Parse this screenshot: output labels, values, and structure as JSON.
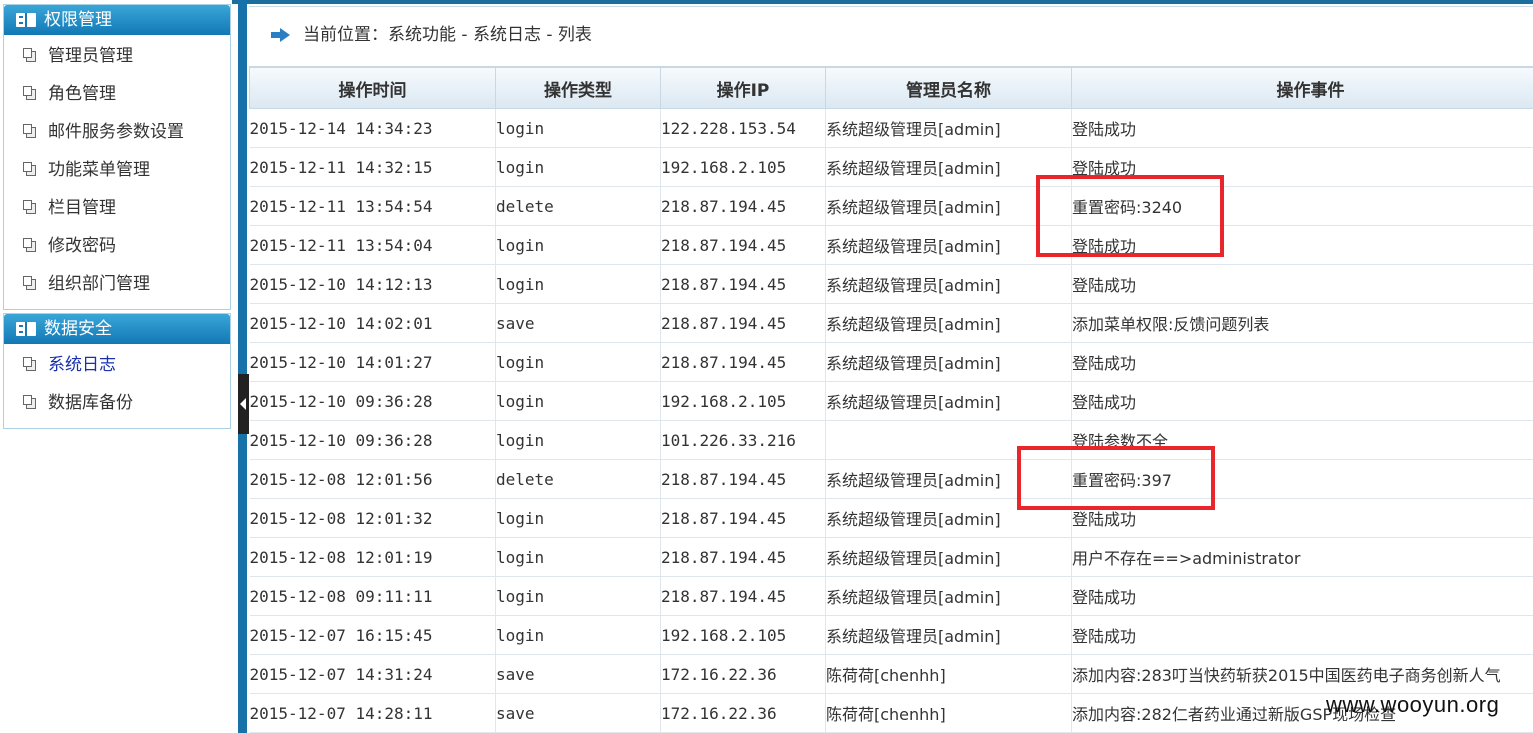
{
  "sidebar": {
    "panels": [
      {
        "title": "权限管理",
        "items": [
          "管理员管理",
          "角色管理",
          "邮件服务参数设置",
          "功能菜单管理",
          "栏目管理",
          "修改密码",
          "组织部门管理"
        ]
      },
      {
        "title": "数据安全",
        "items": [
          "系统日志",
          "数据库备份"
        ]
      }
    ],
    "active_item": "系统日志"
  },
  "breadcrumb": {
    "text": "当前位置：系统功能 - 系统日志 - 列表",
    "icon": "right-arrow-icon"
  },
  "table": {
    "headers": [
      "操作时间",
      "操作类型",
      "操作IP",
      "管理员名称",
      "操作事件"
    ],
    "rows": [
      [
        "2015-12-14 14:34:23",
        "login",
        "122.228.153.54",
        "系统超级管理员[admin]",
        "登陆成功"
      ],
      [
        "2015-12-11 14:32:15",
        "login",
        "192.168.2.105",
        "系统超级管理员[admin]",
        "登陆成功"
      ],
      [
        "2015-12-11 13:54:54",
        "delete",
        "218.87.194.45",
        "系统超级管理员[admin]",
        "重置密码:3240"
      ],
      [
        "2015-12-11 13:54:04",
        "login",
        "218.87.194.45",
        "系统超级管理员[admin]",
        "登陆成功"
      ],
      [
        "2015-12-10 14:12:13",
        "login",
        "218.87.194.45",
        "系统超级管理员[admin]",
        "登陆成功"
      ],
      [
        "2015-12-10 14:02:01",
        "save",
        "218.87.194.45",
        "系统超级管理员[admin]",
        "添加菜单权限:反馈问题列表"
      ],
      [
        "2015-12-10 14:01:27",
        "login",
        "218.87.194.45",
        "系统超级管理员[admin]",
        "登陆成功"
      ],
      [
        "2015-12-10 09:36:28",
        "login",
        "192.168.2.105",
        "系统超级管理员[admin]",
        "登陆成功"
      ],
      [
        "2015-12-10 09:36:28",
        "login",
        "101.226.33.216",
        "",
        "登陆参数不全"
      ],
      [
        "2015-12-08 12:01:56",
        "delete",
        "218.87.194.45",
        "系统超级管理员[admin]",
        "重置密码:397"
      ],
      [
        "2015-12-08 12:01:32",
        "login",
        "218.87.194.45",
        "系统超级管理员[admin]",
        "登陆成功"
      ],
      [
        "2015-12-08 12:01:19",
        "login",
        "218.87.194.45",
        "系统超级管理员[admin]",
        "用户不存在==>administrator"
      ],
      [
        "2015-12-08 09:11:11",
        "login",
        "218.87.194.45",
        "系统超级管理员[admin]",
        "登陆成功"
      ],
      [
        "2015-12-07 16:15:45",
        "login",
        "192.168.2.105",
        "系统超级管理员[admin]",
        "登陆成功"
      ],
      [
        "2015-12-07 14:31:24",
        "save",
        "172.16.22.36",
        "陈荷荷[chenhh]",
        "添加内容:283叮当快药斩获2015中国医药电子商务创新人气"
      ],
      [
        "2015-12-07 14:28:11",
        "save",
        "172.16.22.36",
        "陈荷荷[chenhh]",
        "添加内容:282仁者药业通过新版GSP现场检查"
      ]
    ]
  },
  "watermark": "www.wooyun.org",
  "colors": {
    "accent": "#1b78b5",
    "highlight": "#e8262b",
    "active_link": "#1a2fb0"
  }
}
